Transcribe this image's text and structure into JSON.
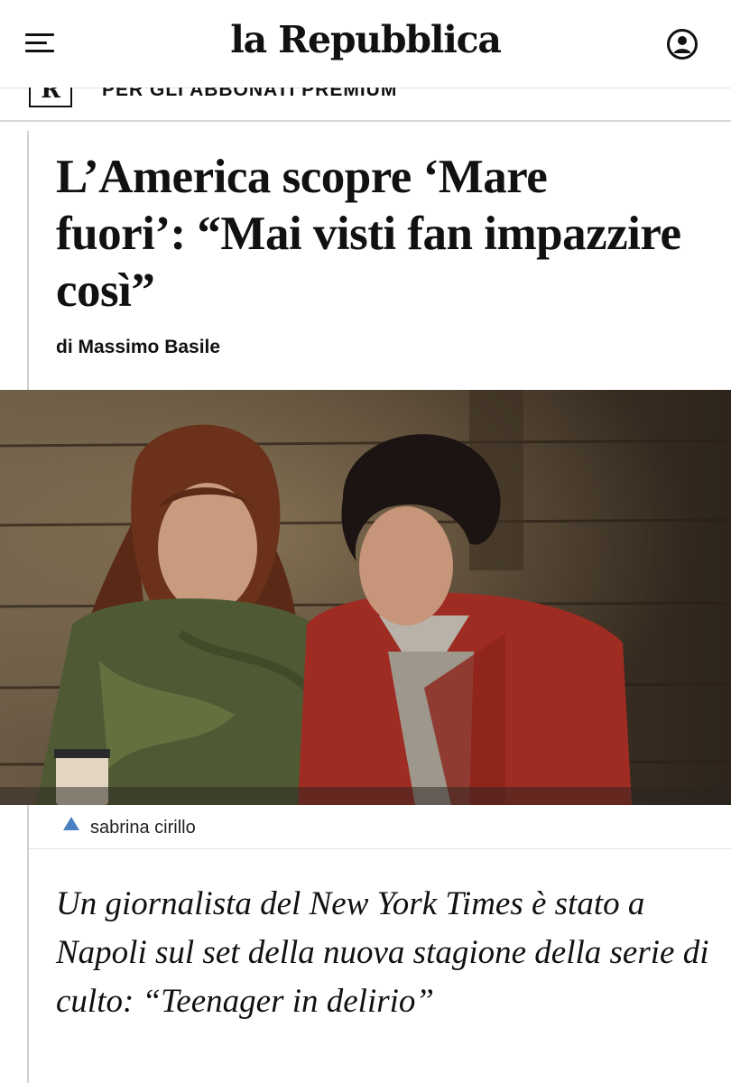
{
  "header": {
    "logo_text": "la Repubblica",
    "menu_icon": "hamburger-menu-icon",
    "account_icon": "user-account-icon"
  },
  "premium": {
    "badge_letter": "R",
    "label": "PER GLI ABBONATI PREMIUM"
  },
  "article": {
    "headline": "L’America scopre ‘Mare fuori’: “Mai visti fan impazzire così”",
    "byline": "di Massimo Basile",
    "image_caption": "sabrina cirillo",
    "caption_icon": "triangle-up-icon",
    "summary": "Un giornalista del New York Times è stato a Napoli sul set della nuova stagione della serie di culto: “Teenager in delirio”"
  },
  "colors": {
    "caption_icon": "#4a7fc1",
    "text": "#111111",
    "rule": "#d0d0d0"
  }
}
